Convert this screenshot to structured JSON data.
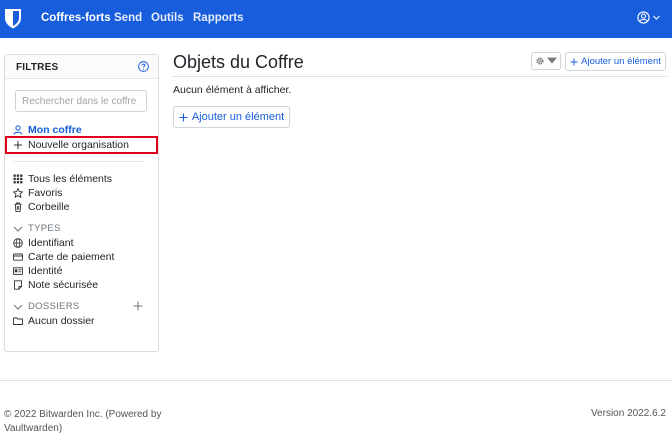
{
  "nav": {
    "items": [
      {
        "label": "Coffres-forts",
        "active": true
      },
      {
        "label": "Send",
        "active": false
      },
      {
        "label": "Outils",
        "active": false
      },
      {
        "label": "Rapports",
        "active": false
      }
    ],
    "account_icon": "account-circle-icon"
  },
  "filters": {
    "title": "FILTRES",
    "search_placeholder": "Rechercher dans le coffre",
    "my_vault": "Mon coffre",
    "new_org": "Nouvelle organisation",
    "all_items": "Tous les éléments",
    "favorites": "Favoris",
    "trash": "Corbeille",
    "types_header": "TYPES",
    "types": [
      "Identifiant",
      "Carte de paiement",
      "Identité",
      "Note sécurisée"
    ],
    "folders_header": "DOSSIERS",
    "no_folder": "Aucun dossier"
  },
  "main": {
    "title": "Objets du Coffre",
    "add_item_top": "Ajouter un élément",
    "empty_message": "Aucun élément à afficher.",
    "add_item": "Ajouter un élément"
  },
  "footer": {
    "copyright": "© 2022 Bitwarden Inc. (Powered by Vaultwarden)",
    "version": "Version 2022.6.2"
  },
  "colors": {
    "brand": "#175ddc",
    "highlight": "#e1001e"
  }
}
